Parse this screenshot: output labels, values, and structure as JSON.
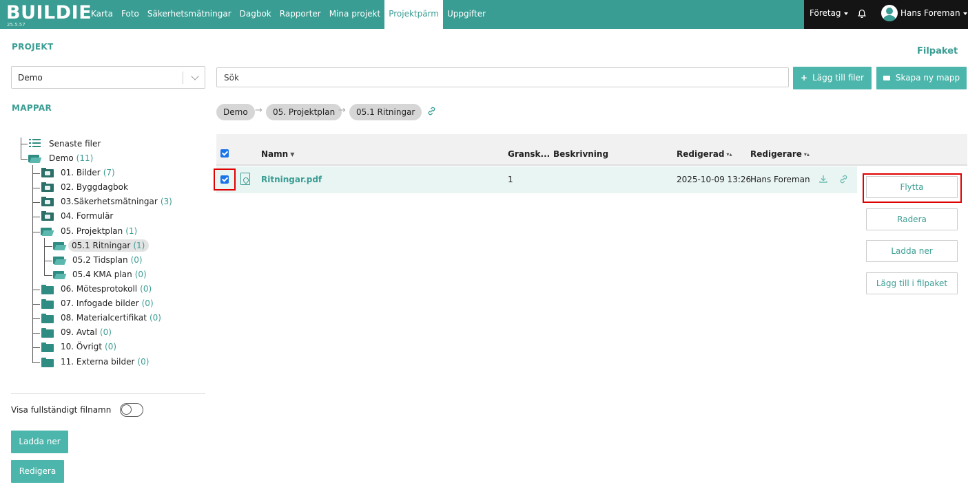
{
  "app": {
    "logo": "BUILDIE",
    "version": "25.5.57"
  },
  "nav": {
    "links": [
      "Karta",
      "Foto",
      "Säkerhetsmätningar",
      "Dagbok",
      "Rapporter",
      "Mina projekt",
      "Projektpärm",
      "Uppgifter"
    ],
    "active": "Projektpärm",
    "company": "Företag",
    "user": "Hans Foreman"
  },
  "sidebar": {
    "project_title": "PROJEKT",
    "project_select": "Demo",
    "folders_title": "MAPPAR",
    "tree": {
      "recent": "Senaste filer",
      "root": {
        "label": "Demo",
        "count": "(11)"
      },
      "items": [
        {
          "label": "01. Bilder",
          "count": "(7)"
        },
        {
          "label": "02. Byggdagbok",
          "count": ""
        },
        {
          "label": "03.Säkerhetsmätningar",
          "count": "(3)"
        },
        {
          "label": "04. Formulär",
          "count": ""
        },
        {
          "label": "05. Projektplan",
          "count": "(1)"
        },
        {
          "label": "05.1 Ritningar",
          "count": "(1)"
        },
        {
          "label": "05.2 Tidsplan",
          "count": "(0)"
        },
        {
          "label": "05.4 KMA plan",
          "count": "(0)"
        },
        {
          "label": "06. Mötesprotokoll",
          "count": "(0)"
        },
        {
          "label": "07. Infogade bilder",
          "count": "(0)"
        },
        {
          "label": "08. Materialcertifikat",
          "count": "(0)"
        },
        {
          "label": "09. Avtal",
          "count": "(0)"
        },
        {
          "label": "10. Övrigt",
          "count": "(0)"
        },
        {
          "label": "11. Externa bilder",
          "count": "(0)"
        }
      ]
    },
    "toggle_label": "Visa fullständigt filnamn",
    "toggle_on": false,
    "download_button": "Ladda ner",
    "edit_button": "Redigera"
  },
  "main": {
    "search_placeholder": "Sök",
    "add_files": "Lägg till filer",
    "new_folder": "Skapa ny mapp",
    "filpaket": "Filpaket",
    "breadcrumb": [
      "Demo",
      "05. Projektplan",
      "05.1 Ritningar"
    ],
    "table": {
      "headers": [
        "Namn",
        "Gransk...",
        "Beskrivning",
        "Redigerad",
        "Redigerare"
      ],
      "rows": [
        {
          "name": "Ritningar.pdf",
          "review": "1",
          "description": "",
          "edited": "2025-10-09 13:26",
          "editor": "Hans Foreman",
          "checked": true
        }
      ]
    },
    "actions": [
      "Flytta",
      "Radera",
      "Ladda ner",
      "Lägg till i filpaket"
    ]
  },
  "colors": {
    "accent": "#3a9d93",
    "accent_light": "#4db6ac",
    "highlight": "#e00000",
    "nav_dark": "#141414"
  }
}
